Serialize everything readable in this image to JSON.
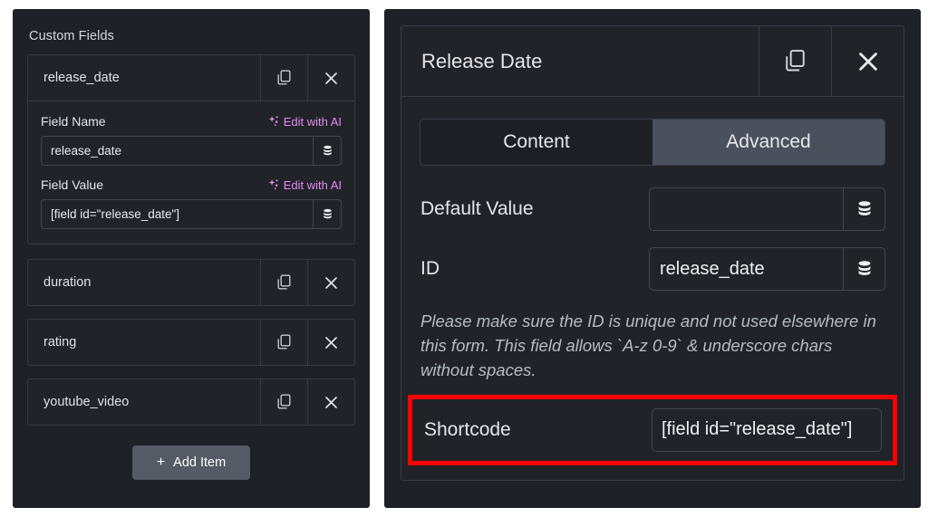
{
  "colors": {
    "panel_bg": "#1f2128",
    "field_bg": "#212329",
    "border": "#383b44",
    "text": "#e4e7ea",
    "ai_accent": "#e28cf0",
    "tab_active_bg": "#4b515c",
    "button_bg": "#555a65",
    "highlight": "#ff0000"
  },
  "left_panel": {
    "title": "Custom Fields",
    "icons": {
      "duplicate": "copy-icon",
      "remove": "close-icon",
      "dynamic": "database-icon",
      "ai": "sparkle-icon"
    },
    "items": [
      {
        "label": "release_date",
        "expanded": true
      },
      {
        "label": "duration",
        "expanded": false
      },
      {
        "label": "rating",
        "expanded": false
      },
      {
        "label": "youtube_video",
        "expanded": false
      }
    ],
    "expanded_item": {
      "field_name": {
        "label": "Field Name",
        "ai_label": "Edit with AI",
        "value": "release_date"
      },
      "field_value": {
        "label": "Field Value",
        "ai_label": "Edit with AI",
        "value": "[field id=\"release_date\"]"
      }
    },
    "add_button": {
      "plus": "+",
      "label": "Add Item"
    }
  },
  "right_panel": {
    "header": {
      "title": "Release Date",
      "duplicate_icon": "copy-icon",
      "close_icon": "close-icon"
    },
    "tabs": [
      {
        "label": "Content",
        "active": false
      },
      {
        "label": "Advanced",
        "active": true
      }
    ],
    "rows": [
      {
        "label": "Default Value",
        "value": "",
        "dynamic_icon": "database-icon"
      },
      {
        "label": "ID",
        "value": "release_date",
        "dynamic_icon": "database-icon"
      }
    ],
    "helper_text": "Please make sure the ID is unique and not used elsewhere in this form. This field allows `A-z 0-9` & underscore chars without spaces.",
    "shortcode": {
      "label": "Shortcode",
      "value": "[field id=\"release_date\"]",
      "highlighted": true
    }
  }
}
